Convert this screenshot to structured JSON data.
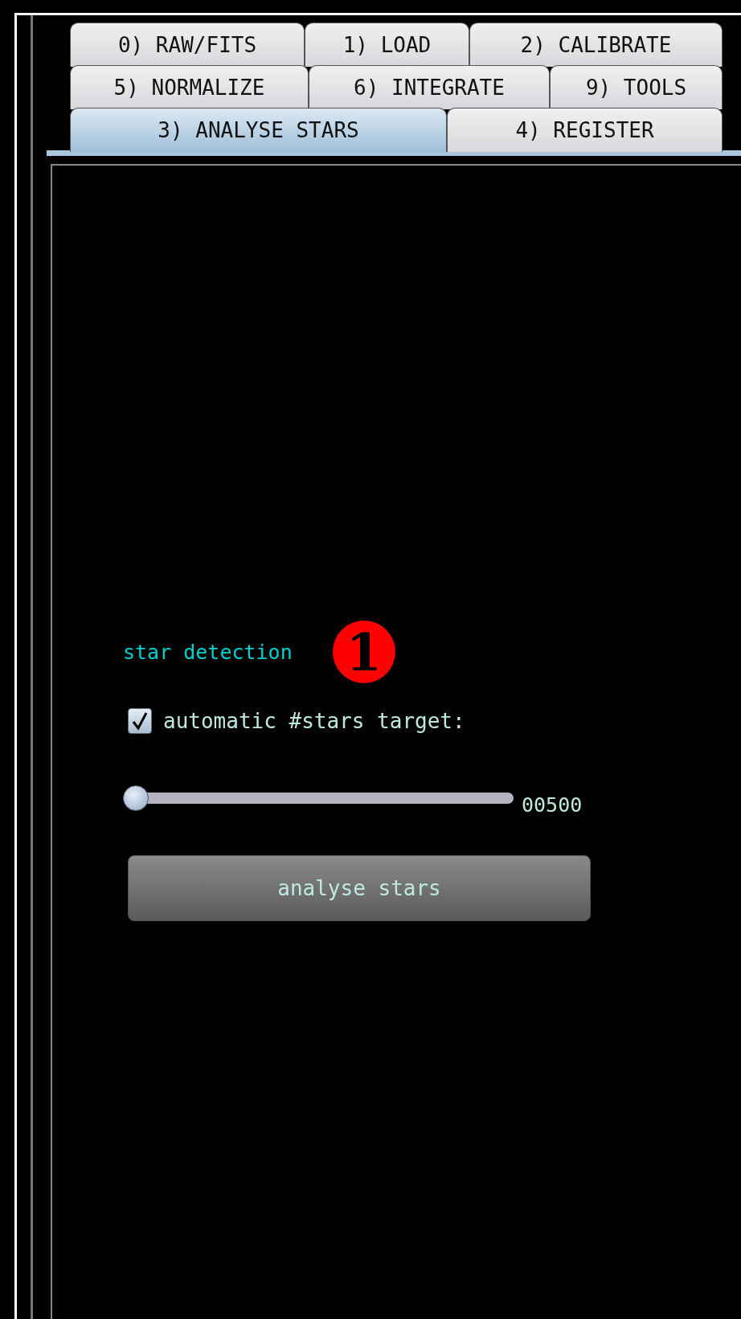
{
  "tab_rows": [
    {
      "tabs": [
        {
          "label": "0) RAW/FITS",
          "selected": false
        },
        {
          "label": "1) LOAD",
          "selected": false
        },
        {
          "label": "2) CALIBRATE",
          "selected": false
        }
      ]
    },
    {
      "tabs": [
        {
          "label": "5) NORMALIZE",
          "selected": false
        },
        {
          "label": "6) INTEGRATE",
          "selected": false
        },
        {
          "label": "9) TOOLS",
          "selected": false
        }
      ]
    },
    {
      "tabs": [
        {
          "label": "3) ANALYSE STARS",
          "selected": true
        },
        {
          "label": "4) REGISTER",
          "selected": false
        }
      ]
    }
  ],
  "panel": {
    "section_title": "star detection",
    "callout": "1",
    "checkbox": {
      "label": "automatic #stars target:",
      "checked": true
    },
    "slider": {
      "level": 0.0,
      "reading": "00500"
    },
    "button": "analyse stars"
  }
}
